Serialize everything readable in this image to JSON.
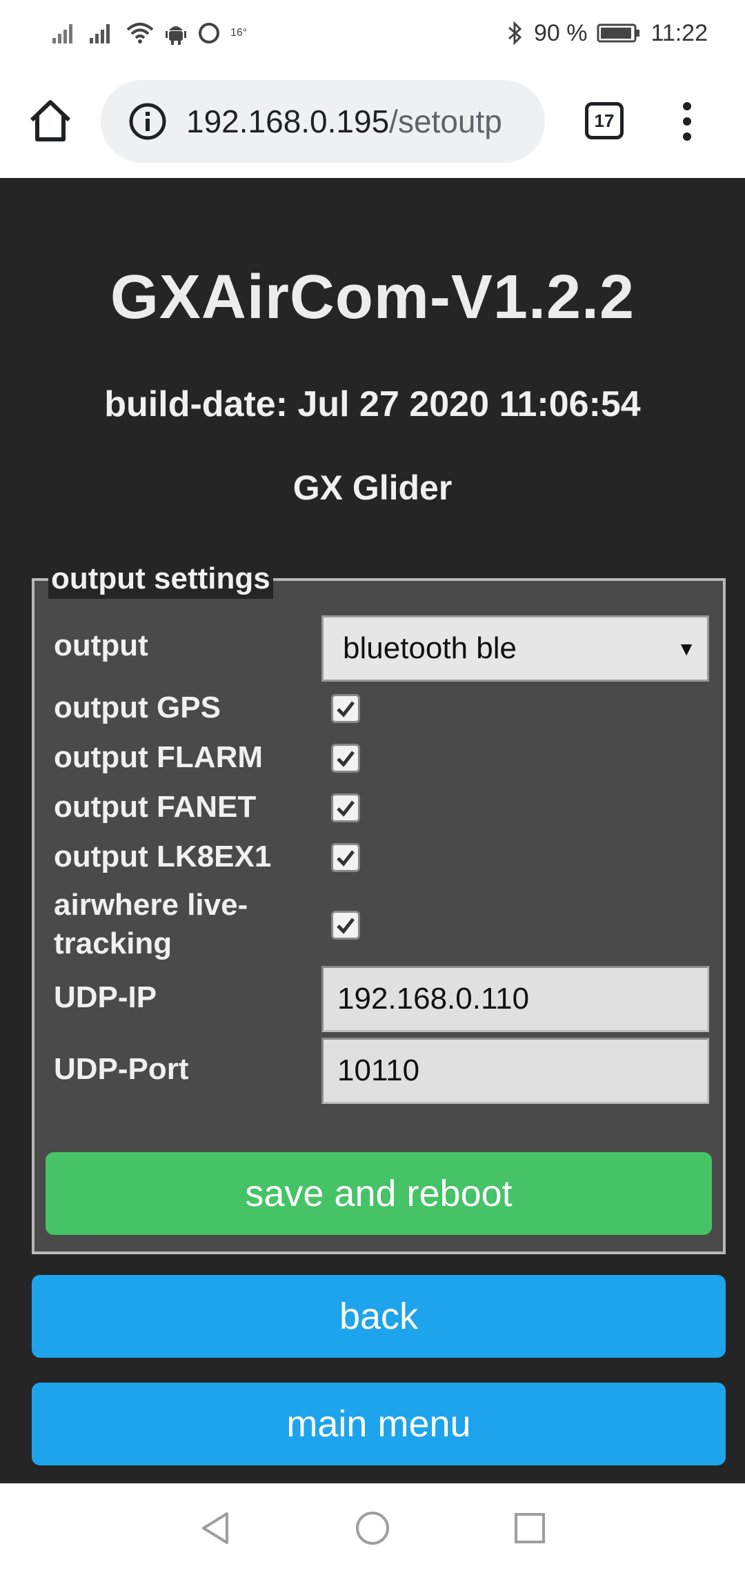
{
  "status_bar": {
    "battery_percent": "90 %",
    "time": "11:22",
    "icons": [
      "signal-icon",
      "signal-icon",
      "wifi-icon",
      "android-debug-icon",
      "circle-icon",
      "temperature-icon",
      "bluetooth-icon",
      "battery-icon"
    ],
    "temp_label": "16°"
  },
  "browser": {
    "url_host": "192.168.0.195",
    "url_path": "/setoutp",
    "tab_count": "17"
  },
  "page": {
    "title": "GXAirCom-V1.2.2",
    "build_date": "build-date: Jul 27 2020 11:06:54",
    "device_name": "GX Glider",
    "fieldset_legend": "output settings",
    "rows": {
      "output_label": "output",
      "output_value": "bluetooth ble",
      "gps_label": "output GPS",
      "flarm_label": "output FLARM",
      "fanet_label": "output FANET",
      "lk8ex1_label": "output LK8EX1",
      "airwhere_label_1": "airwhere live-",
      "airwhere_label_2": "tracking",
      "udp_ip_label": "UDP-IP",
      "udp_ip_value": "192.168.0.110",
      "udp_port_label": "UDP-Port",
      "udp_port_value": "10110"
    },
    "checkboxes": {
      "gps": true,
      "flarm": true,
      "fanet": true,
      "lk8ex1": true,
      "airwhere": true
    },
    "save_button": "save and reboot",
    "back_button": "back",
    "main_menu_button": "main menu"
  },
  "colors": {
    "page_bg": "#252525",
    "fieldset_bg": "#4a4a4a",
    "save_green": "#45c366",
    "nav_blue": "#1ea4ed"
  }
}
